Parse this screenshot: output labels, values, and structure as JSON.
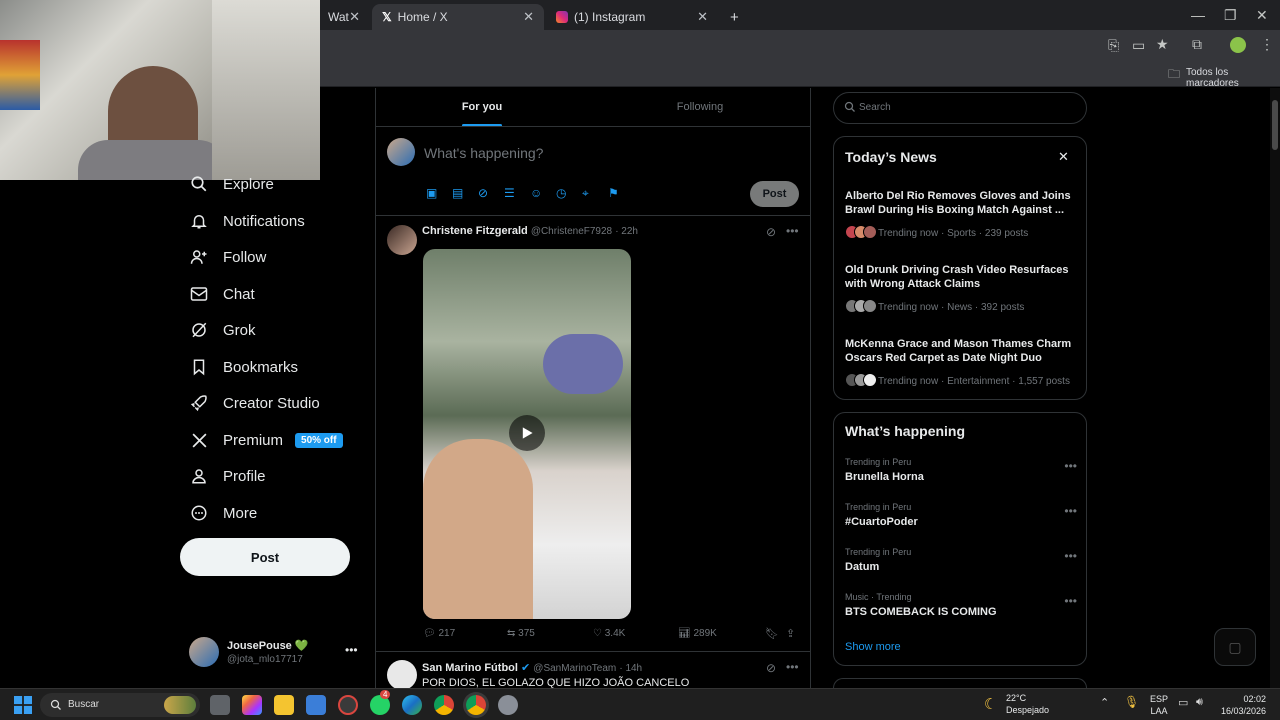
{
  "browser": {
    "tabs": [
      {
        "title": "Watch L",
        "active": false
      },
      {
        "title": "Home / X",
        "active": true
      },
      {
        "title": "(1) Instagram",
        "active": false
      }
    ],
    "new_tab": "+",
    "bookmarks_label": "Todos los marcadores"
  },
  "sidebar": {
    "items": [
      {
        "label": "Explore",
        "icon": "search-icon"
      },
      {
        "label": "Notifications",
        "icon": "bell-icon"
      },
      {
        "label": "Follow",
        "icon": "person-add-icon"
      },
      {
        "label": "Chat",
        "icon": "mail-icon"
      },
      {
        "label": "Grok",
        "icon": "grok-icon"
      },
      {
        "label": "Bookmarks",
        "icon": "bookmark-icon"
      },
      {
        "label": "Creator Studio",
        "icon": "rocket-icon"
      },
      {
        "label": "Premium",
        "icon": "x-logo-icon"
      },
      {
        "label": "Profile",
        "icon": "person-icon"
      },
      {
        "label": "More",
        "icon": "more-circle-icon"
      }
    ],
    "premium_badge": "50% off",
    "post_label": "Post",
    "account": {
      "name": "JousePouse",
      "heart": "💚",
      "handle": "@jota_mlo17717"
    }
  },
  "timeline": {
    "tabs": [
      "For you",
      "Following"
    ],
    "composer": {
      "placeholder": "What's happening?",
      "post_label": "Post"
    },
    "posts": [
      {
        "author": "Christene Fitzgerald",
        "handle": "@ChristeneF7928",
        "time": "22h",
        "stats": {
          "replies": "217",
          "reposts": "375",
          "likes": "3.4K",
          "views": "289K"
        }
      },
      {
        "author": "San Marino Fútbol",
        "handle": "@SanMarinoTeam",
        "time": "14h",
        "text": "POR DIOS, EL GOLAZO QUE HIZO JOÃO CANCELO"
      }
    ]
  },
  "right": {
    "search_placeholder": "Search",
    "news": {
      "title": "Today’s News",
      "items": [
        {
          "headline": "Alberto Del Rio Removes Gloves and Joins Brawl During His Boxing Match Against ...",
          "meta": "Trending now · Sports · 239 posts"
        },
        {
          "headline": "Old Drunk Driving Crash Video Resurfaces with Wrong Attack Claims",
          "meta": "Trending now · News · 392 posts"
        },
        {
          "headline": "McKenna Grace and Mason Thames Charm Oscars Red Carpet as Date Night Duo",
          "meta": "Trending now · Entertainment · 1,557 posts"
        }
      ]
    },
    "happening": {
      "title": "What’s happening",
      "items": [
        {
          "category": "Trending in Peru",
          "name": "Brunella Horna"
        },
        {
          "category": "Trending in Peru",
          "name": "#CuartoPoder"
        },
        {
          "category": "Trending in Peru",
          "name": "Datum"
        },
        {
          "category": "Music · Trending",
          "name": "BTS COMEBACK IS COMING"
        }
      ],
      "show_more": "Show more"
    }
  },
  "taskbar": {
    "search_label": "Buscar",
    "weather": {
      "temp": "22°C",
      "desc": "Despejado"
    },
    "lang": {
      "line1": "ESP",
      "line2": "LAA"
    },
    "clock": {
      "time": "02:02",
      "date": "16/03/2026"
    },
    "whatsapp_badge": "4"
  },
  "colors": {
    "accent": "#1d9bf0",
    "bg": "#000000",
    "border": "#2f3336",
    "muted": "#71767b"
  }
}
